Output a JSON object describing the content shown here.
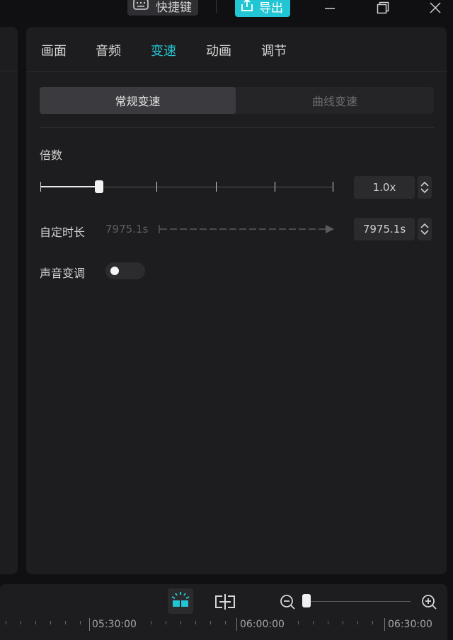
{
  "titlebar": {
    "shortcut_label": "快捷键",
    "export_label": "导出",
    "accent": "#22c5d3"
  },
  "tabs": [
    "画面",
    "音频",
    "变速",
    "动画",
    "调节"
  ],
  "active_tab_index": 2,
  "speed_mode": {
    "options": [
      "常规变速",
      "曲线变速"
    ],
    "selected_index": 0
  },
  "multiplier": {
    "label": "倍数",
    "value": "1.0x",
    "slider_position": 0.2
  },
  "custom_duration": {
    "label": "自定时长",
    "original": "7975.1s",
    "value": "7975.1s"
  },
  "pitch": {
    "label": "声音变调",
    "enabled": false
  },
  "timeline": {
    "zoom_level": 0.02,
    "ruler_labels": [
      "05:30:00",
      "06:00:00",
      "06:30:00"
    ]
  }
}
